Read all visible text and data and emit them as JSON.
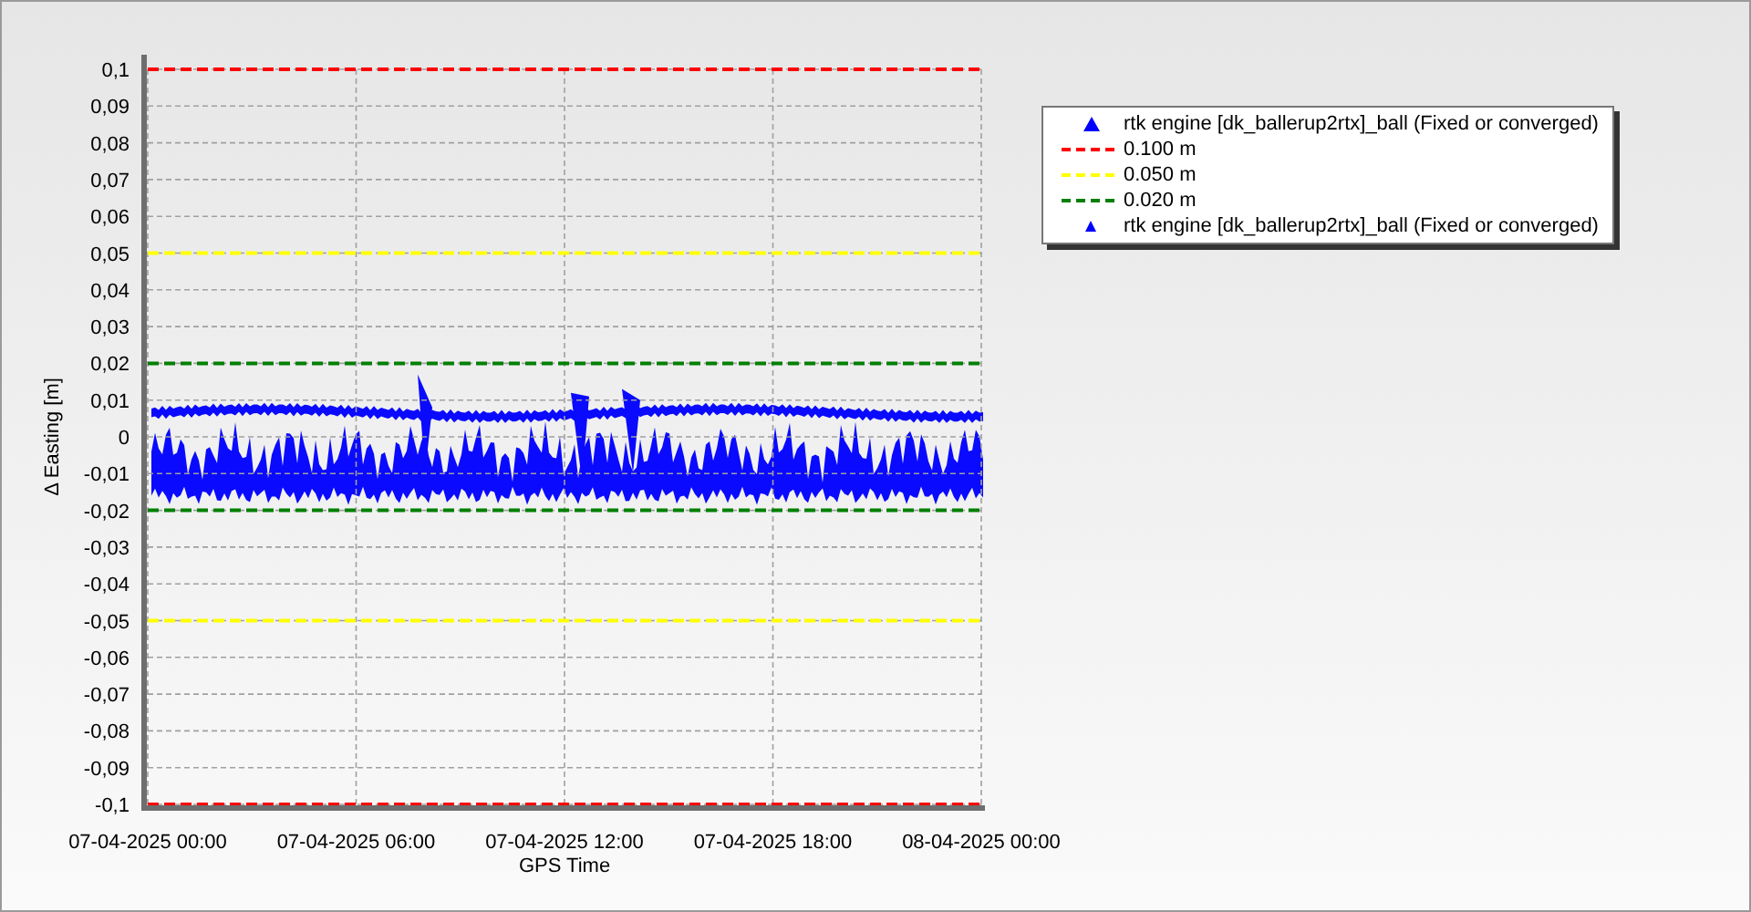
{
  "chart_data": {
    "type": "line",
    "xlabel": "GPS Time",
    "ylabel": "Δ Easting [m]",
    "grid": true,
    "categories": [
      "07-04-2025 00:00",
      "07-04-2025 06:00",
      "07-04-2025 12:00",
      "07-04-2025 18:00",
      "08-04-2025 00:00"
    ],
    "ylim": [
      -0.1,
      0.1
    ],
    "yticks": [
      {
        "value": 0.1,
        "label": "0,1"
      },
      {
        "value": 0.09,
        "label": "0,09"
      },
      {
        "value": 0.08,
        "label": "0,08"
      },
      {
        "value": 0.07,
        "label": "0,07"
      },
      {
        "value": 0.06,
        "label": "0,06"
      },
      {
        "value": 0.05,
        "label": "0,05"
      },
      {
        "value": 0.04,
        "label": "0,04"
      },
      {
        "value": 0.03,
        "label": "0,03"
      },
      {
        "value": 0.02,
        "label": "0,02"
      },
      {
        "value": 0.01,
        "label": "0,01"
      },
      {
        "value": 0,
        "label": "0"
      },
      {
        "value": -0.01,
        "label": "-0,01"
      },
      {
        "value": -0.02,
        "label": "-0,02"
      },
      {
        "value": -0.03,
        "label": "-0,03"
      },
      {
        "value": -0.04,
        "label": "-0,04"
      },
      {
        "value": -0.05,
        "label": "-0,05"
      },
      {
        "value": -0.06,
        "label": "-0,06"
      },
      {
        "value": -0.07,
        "label": "-0,07"
      },
      {
        "value": -0.08,
        "label": "-0,08"
      },
      {
        "value": -0.09,
        "label": "-0,09"
      },
      {
        "value": -0.1,
        "label": "-0,1"
      }
    ],
    "series": [
      {
        "name": "0.100 m",
        "color": "#ff0000",
        "line_style": "dashed",
        "values": [
          0.1,
          0.1,
          0.1,
          0.1,
          0.1
        ]
      },
      {
        "color": "#ff0000",
        "line_style": "dashed",
        "values": [
          -0.1,
          -0.1,
          -0.1,
          -0.1,
          -0.1
        ]
      },
      {
        "name": "0.050 m",
        "color": "#ffff00",
        "line_style": "dashed",
        "values": [
          0.05,
          0.05,
          0.05,
          0.05,
          0.05
        ]
      },
      {
        "color": "#ffff00",
        "line_style": "dashed",
        "values": [
          -0.05,
          -0.05,
          -0.05,
          -0.05,
          -0.05
        ]
      },
      {
        "name": "0.020 m",
        "color": "#008000",
        "line_style": "dashed",
        "values": [
          0.02,
          0.02,
          0.02,
          0.02,
          0.02
        ]
      },
      {
        "color": "#008000",
        "line_style": "dashed",
        "values": [
          -0.02,
          -0.02,
          -0.02,
          -0.02,
          -0.02
        ]
      }
    ]
  },
  "legend": [
    {
      "kind": "marker",
      "label": "rtk engine [dk_ballerup2rtx]_ball (Fixed or converged)",
      "color": "#0000ff"
    },
    {
      "kind": "small-marker",
      "label": "rtk engine [dk_ballerup2rtx]_ball (Fixed or converged)",
      "color": "#0000ff"
    }
  ]
}
